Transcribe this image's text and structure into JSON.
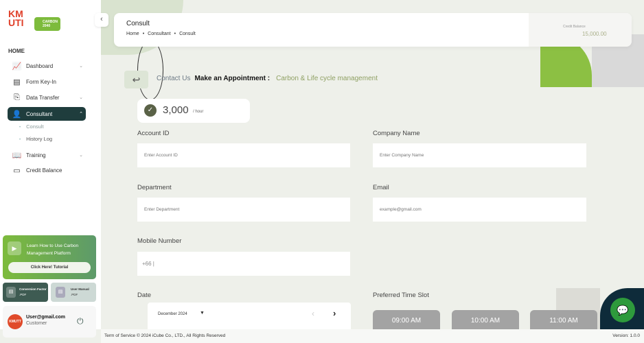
{
  "logo": {
    "kmutt": "KMUTT",
    "carbon": "CARBON 2040"
  },
  "sidebar": {
    "section": "HOME",
    "items": [
      {
        "label": "Dashboard",
        "icon": "chart-line-icon"
      },
      {
        "label": "Form Key-In",
        "icon": "form-icon"
      },
      {
        "label": "Data Transfer",
        "icon": "file-transfer-icon"
      },
      {
        "label": "Consultant",
        "icon": "user-check-icon"
      },
      {
        "label": "Training",
        "icon": "book-icon"
      },
      {
        "label": "Credit Balance",
        "icon": "card-icon"
      }
    ],
    "subitems": [
      "Consult",
      "History Log"
    ],
    "tutorial": {
      "text": "Learn How to Use Carbon Management Platform",
      "button": "Click Here! Tutorial"
    },
    "conversion": {
      "title": "Conversion Factor",
      "sub": ".PDF"
    },
    "manual": {
      "title": "User Manual",
      "sub": ".PDF"
    },
    "user": {
      "email": "User@gmail.com",
      "role": "Customer"
    }
  },
  "header": {
    "title": "Consult",
    "breadcrumb": [
      "Home",
      "Consultant",
      "Consult"
    ],
    "credit_label": "Credit Balance",
    "credit_value": "15,000.00"
  },
  "appointment": {
    "contact": "Contact Us",
    "make": "Make an Appointment :",
    "topic": "Carbon & Life cycle management"
  },
  "price": {
    "value": "3,000",
    "unit": "/ hour"
  },
  "form": {
    "account_id": {
      "label": "Account ID",
      "placeholder": "Enter Account ID"
    },
    "company": {
      "label": "Company Name",
      "placeholder": "Enter Company Name"
    },
    "department": {
      "label": "Department",
      "placeholder": "Enter Department"
    },
    "email": {
      "label": "Email",
      "placeholder": "example@gmail.com"
    },
    "mobile": {
      "label": "Mobile Number",
      "value": "+66 |"
    },
    "date": {
      "label": "Date",
      "month": "December 2024"
    },
    "timeslot": {
      "label": "Preferred Time Slot",
      "slots": [
        "09:00 AM",
        "10:00 AM",
        "11:00 AM"
      ]
    }
  },
  "footer": {
    "left": "Term of Service © 2024 iCube Co., LTD., All Rights Reserved",
    "version": "Version: 1.0.0"
  },
  "colors": {
    "primary": "#1f3d3d",
    "green": "#8cc043",
    "topic": "#8fa063"
  }
}
